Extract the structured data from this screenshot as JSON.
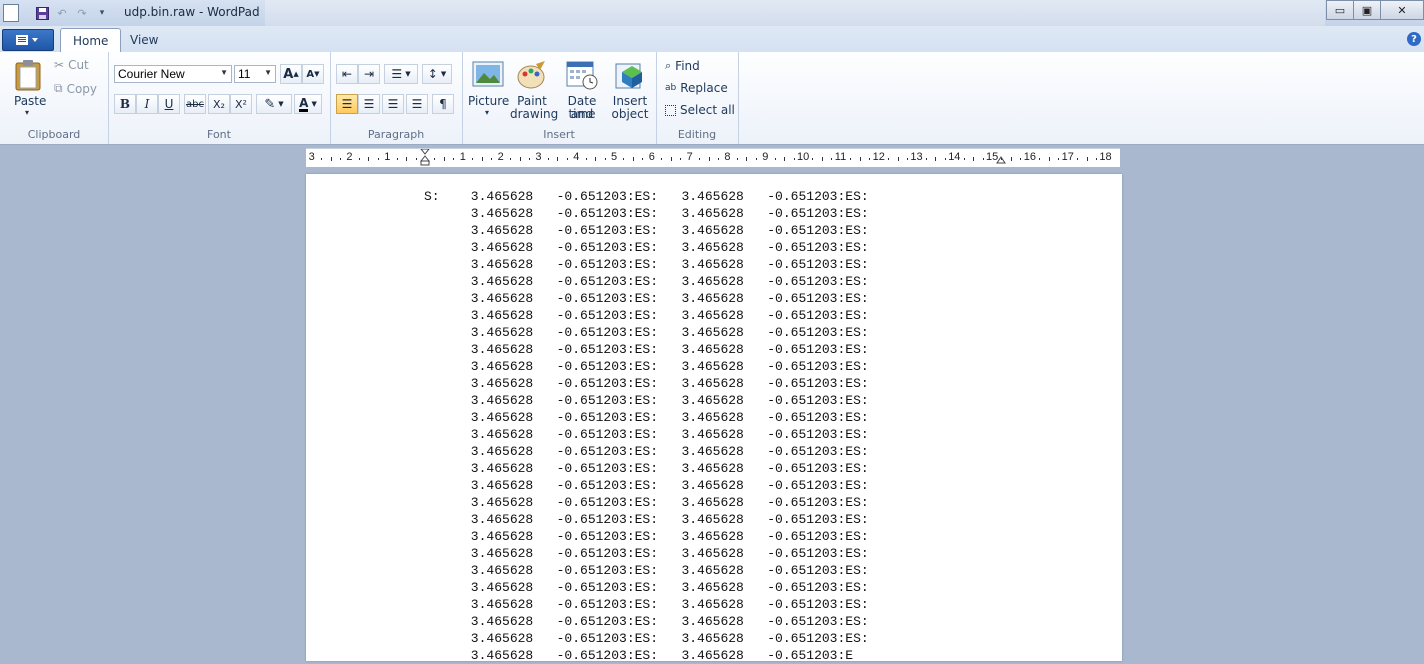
{
  "window": {
    "title": "udp.bin.raw - WordPad",
    "controls": {
      "minimize": "▭",
      "maximize": "▣",
      "close": "✕"
    }
  },
  "tabs": [
    {
      "label": "Home"
    },
    {
      "label": "View"
    }
  ],
  "help_label": "?",
  "ribbon": {
    "clipboard": {
      "paste": "Paste",
      "cut": "Cut",
      "copy": "Copy",
      "group_label": "Clipboard"
    },
    "font": {
      "family": "Courier New",
      "size": "11",
      "grow": "A",
      "shrink": "A",
      "bold": "B",
      "italic": "I",
      "underline": "U",
      "strike": "abc",
      "subscript": "X₂",
      "superscript": "X²",
      "color_glyph": "A",
      "group_label": "Font"
    },
    "paragraph": {
      "group_label": "Paragraph"
    },
    "insert": {
      "picture": "Picture",
      "paint_1": "Paint",
      "paint_2": "drawing",
      "datetime_1": "Date and",
      "datetime_2": "time",
      "object_1": "Insert",
      "object_2": "object",
      "group_label": "Insert"
    },
    "editing": {
      "find": "Find",
      "replace": "Replace",
      "select_all": "Select all",
      "group_label": "Editing"
    }
  },
  "ruler": {
    "labels": [
      "3",
      "2",
      "1",
      "1",
      "2",
      "3",
      "4",
      "5",
      "6",
      "7",
      "8",
      "9",
      "10",
      "11",
      "12",
      "13",
      "14",
      "15",
      "16",
      "17",
      "18"
    ]
  },
  "document": {
    "first_line": "S:    3.465628   -0.651203:ES:   3.465628   -0.651203:ES:",
    "repeat_line": "      3.465628   -0.651203:ES:   3.465628   -0.651203:ES:",
    "repeat_count": 26,
    "last_line": "      3.465628   -0.651203:ES:   3.465628   -0.651203:E"
  }
}
